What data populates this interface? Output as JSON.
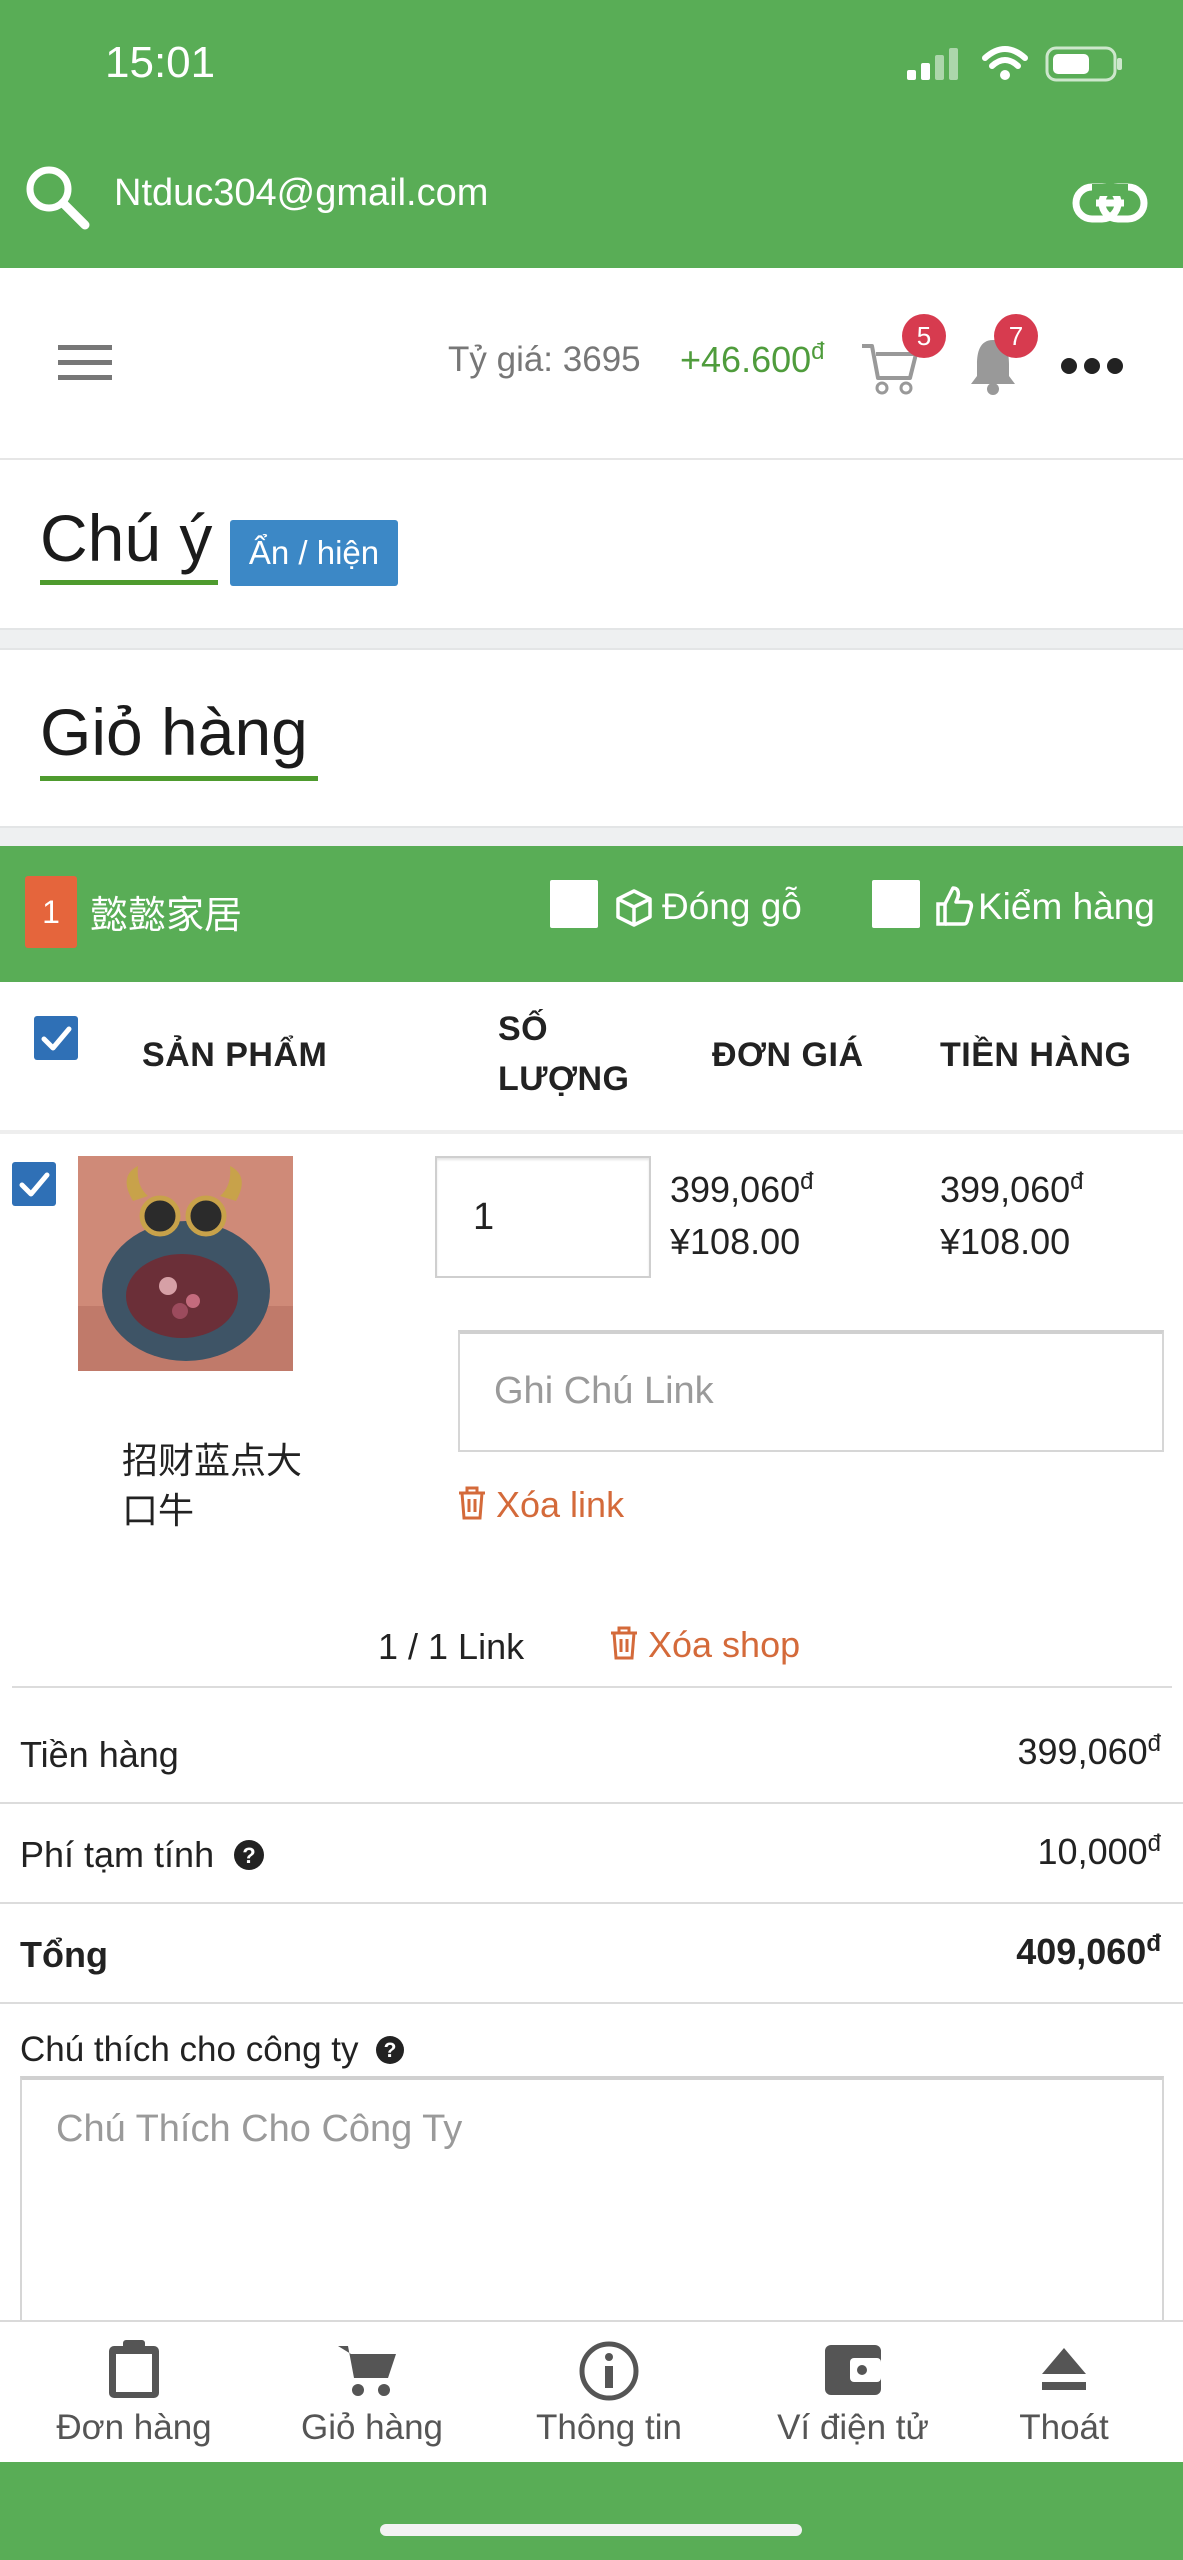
{
  "status_bar": {
    "time": "15:01"
  },
  "url_bar": {
    "url": "Ntduc304@gmail.com"
  },
  "header": {
    "exchange_rate": "Tỷ giá: 3695",
    "balance": "+46.600",
    "currency_symbol": "đ",
    "cart_count": "5",
    "notification_count": "7"
  },
  "notice": {
    "title": "Chú ý",
    "toggle_label": "Ẩn / hiện"
  },
  "cart": {
    "title": "Giỏ hàng"
  },
  "shop": {
    "index": "1",
    "name": "懿懿家居",
    "wood_pack_label": "Đóng gỗ",
    "inspect_label": "Kiểm hàng"
  },
  "table": {
    "headers": {
      "product": "SẢN PHẨM",
      "qty_line1": "SỐ",
      "qty_line2": "LƯỢNG",
      "unit_price": "ĐƠN GIÁ",
      "total": "TIỀN HÀNG"
    },
    "item": {
      "name_line1": "招财蓝点大",
      "name_line2": "口牛",
      "quantity": "1",
      "unit_price_vnd": "399,060",
      "unit_price_cny": "¥108.00",
      "total_vnd": "399,060",
      "total_cny": "¥108.00",
      "note_placeholder": "Ghi Chú Link",
      "delete_link_label": "Xóa link"
    }
  },
  "shop_footer": {
    "link_count": "1 / 1 Link",
    "delete_shop_label": "Xóa shop"
  },
  "summary": {
    "subtotal_label": "Tiền hàng",
    "subtotal_value": "399,060",
    "fee_label": "Phí tạm tính",
    "fee_value": "10,000",
    "total_label": "Tổng",
    "total_value": "409,060"
  },
  "company_note": {
    "label": "Chú thích cho công ty",
    "placeholder": "Chú Thích Cho Công Ty"
  },
  "tabs": [
    {
      "label": "Đơn hàng",
      "icon": "clipboard-icon"
    },
    {
      "label": "Giỏ hàng",
      "icon": "cart-icon"
    },
    {
      "label": "Thông tin",
      "icon": "info-icon"
    },
    {
      "label": "Ví điện tử",
      "icon": "wallet-icon"
    },
    {
      "label": "Thoát",
      "icon": "eject-icon"
    }
  ],
  "colors": {
    "primary_green": "#59ad56",
    "badge_red": "#d73b4f",
    "link_orange": "#d46a3a",
    "checkbox_blue": "#2f70b6"
  }
}
